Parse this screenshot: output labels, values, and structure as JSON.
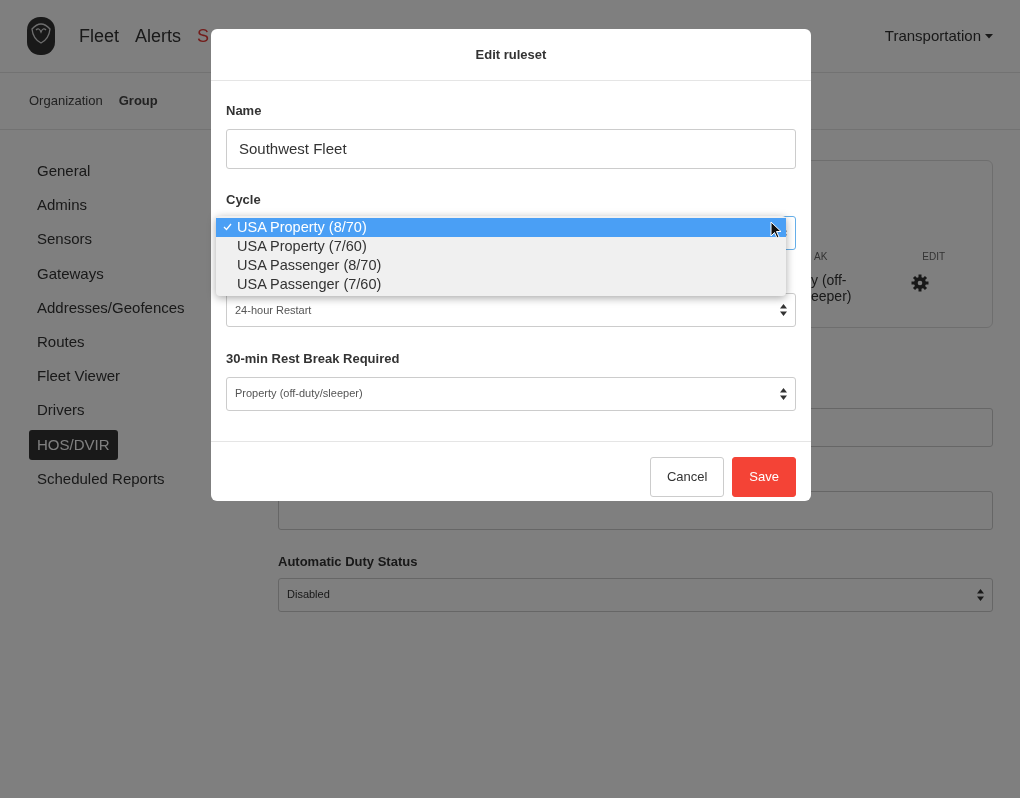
{
  "navbar": {
    "links": [
      {
        "label": "Fleet",
        "selected": false
      },
      {
        "label": "Alerts",
        "selected": false
      },
      {
        "label": "S",
        "selected": true
      }
    ],
    "org_menu": "Transportation"
  },
  "subnav": [
    {
      "label": "Organization",
      "selected": false
    },
    {
      "label": "Group",
      "selected": true
    }
  ],
  "sidebar": {
    "items": [
      {
        "label": "General",
        "selected": false
      },
      {
        "label": "Admins",
        "selected": false
      },
      {
        "label": "Sensors",
        "selected": false
      },
      {
        "label": "Gateways",
        "selected": false
      },
      {
        "label": "Addresses/Geofences",
        "selected": false
      },
      {
        "label": "Routes",
        "selected": false
      },
      {
        "label": "Fleet Viewer",
        "selected": false
      },
      {
        "label": "Drivers",
        "selected": false
      },
      {
        "label": "HOS/DVIR",
        "selected": true
      },
      {
        "label": "Scheduled Reports",
        "selected": false
      }
    ]
  },
  "ruleset_table": {
    "columns": [
      "AK",
      "EDIT"
    ],
    "row": {
      "cell_lines": [
        "y (off-",
        "eeper)"
      ]
    }
  },
  "settings": {
    "automatic_duty_status": {
      "label": "Automatic Duty Status",
      "value": "Disabled"
    }
  },
  "modal": {
    "title": "Edit ruleset",
    "name": {
      "label": "Name",
      "value": "Southwest Fleet"
    },
    "cycle": {
      "label": "Cycle",
      "options": [
        {
          "label": "USA Property (8/70)",
          "selected": true
        },
        {
          "label": "USA Property (7/60)",
          "selected": false
        },
        {
          "label": "USA Passenger (8/70)",
          "selected": false
        },
        {
          "label": "USA Passenger (7/60)",
          "selected": false
        }
      ]
    },
    "restart": {
      "value": "24-hour Restart"
    },
    "rest_break": {
      "label": "30-min Rest Break Required",
      "value": "Property (off-duty/sleeper)"
    },
    "buttons": [
      {
        "label": "Cancel",
        "kind": "secondary"
      },
      {
        "label": "Save",
        "kind": "primary"
      }
    ]
  }
}
